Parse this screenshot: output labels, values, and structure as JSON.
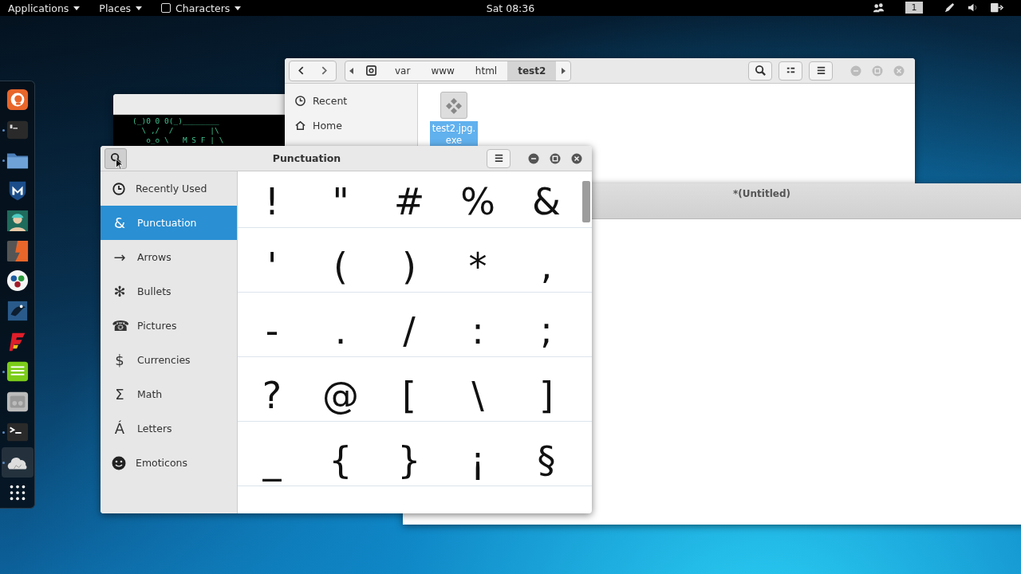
{
  "top_bar": {
    "menus": [
      {
        "label": "Applications",
        "kind": "plain"
      },
      {
        "label": "Places",
        "kind": "plain"
      },
      {
        "label": "Characters",
        "kind": "app"
      }
    ],
    "clock": "Sat 08:36",
    "workspace": "1"
  },
  "dock": {
    "items": [
      {
        "kind": "swirl",
        "running": false,
        "selected": false
      },
      {
        "kind": "terminal",
        "running": true,
        "selected": false
      },
      {
        "kind": "folder",
        "running": true,
        "selected": false
      },
      {
        "kind": "shield",
        "running": false,
        "selected": false
      },
      {
        "kind": "figure",
        "running": false,
        "selected": false
      },
      {
        "kind": "split",
        "running": false,
        "selected": false
      },
      {
        "kind": "dots",
        "running": false,
        "selected": false
      },
      {
        "kind": "square",
        "running": false,
        "selected": false
      },
      {
        "kind": "zigzag",
        "running": false,
        "selected": false
      },
      {
        "kind": "notes",
        "running": true,
        "selected": false
      },
      {
        "kind": "panel",
        "running": false,
        "selected": false
      },
      {
        "kind": "prompt",
        "running": true,
        "selected": false
      },
      {
        "kind": "cloud",
        "running": true,
        "selected": true
      },
      {
        "kind": "grid",
        "running": false,
        "selected": false
      }
    ]
  },
  "terminal": {
    "lines": [
      "(_)0 0 0(_)________",
      "  \\ ,/  /        |\\",
      "   o_o \\   M S F | \\"
    ]
  },
  "files": {
    "path": [
      {
        "label": "var",
        "selected": false
      },
      {
        "label": "www",
        "selected": false
      },
      {
        "label": "html",
        "selected": false
      },
      {
        "label": "test2",
        "selected": true
      }
    ],
    "sidebar": [
      {
        "kind": "recent",
        "label": "Recent"
      },
      {
        "kind": "home",
        "label": "Home"
      }
    ],
    "items": [
      {
        "label_lines": [
          "test2.jpg.",
          "exe"
        ],
        "selected": true
      }
    ]
  },
  "editor": {
    "title": "*(Untitled)"
  },
  "characters": {
    "title": "Punctuation",
    "categories": [
      {
        "kind": "clock",
        "label": "Recently Used",
        "selected": false
      },
      {
        "kind": "glyph",
        "symbol": "&",
        "label": "Punctuation",
        "selected": true
      },
      {
        "kind": "glyph",
        "symbol": "→",
        "label": "Arrows",
        "selected": false
      },
      {
        "kind": "glyph",
        "symbol": "✻",
        "label": "Bullets",
        "selected": false
      },
      {
        "kind": "glyph",
        "symbol": "☎",
        "label": "Pictures",
        "selected": false
      },
      {
        "kind": "glyph",
        "symbol": "$",
        "label": "Currencies",
        "selected": false
      },
      {
        "kind": "glyph",
        "symbol": "Σ",
        "label": "Math",
        "selected": false
      },
      {
        "kind": "glyph",
        "symbol": "Á",
        "label": "Letters",
        "selected": false
      },
      {
        "kind": "smiley",
        "label": "Emoticons",
        "selected": false
      }
    ],
    "rows": [
      [
        "!",
        "\"",
        "#",
        "%",
        "&"
      ],
      [
        "'",
        "(",
        ")",
        "*",
        ","
      ],
      [
        "-",
        ".",
        "/",
        ":",
        ";"
      ],
      [
        "?",
        "@",
        "[",
        "\\",
        "]"
      ],
      [
        "_",
        "{",
        "}",
        "¡",
        "§"
      ]
    ]
  }
}
